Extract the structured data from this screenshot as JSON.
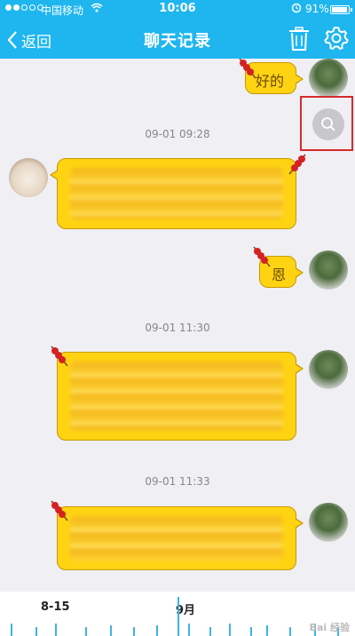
{
  "status": {
    "carrier": "中国移动",
    "time": "10:06",
    "battery": "91%"
  },
  "nav": {
    "back_label": "返回",
    "title": "聊天记录"
  },
  "messages": [
    {
      "type": "sent",
      "text": "好的"
    },
    {
      "type": "timestamp",
      "text": "09-01 09:28"
    },
    {
      "type": "received",
      "text": ""
    },
    {
      "type": "sent",
      "text": "恩"
    },
    {
      "type": "timestamp",
      "text": "09-01 11:30"
    },
    {
      "type": "sent",
      "text": ""
    },
    {
      "type": "timestamp",
      "text": "09-01 11:33"
    },
    {
      "type": "sent",
      "text": ""
    }
  ],
  "timeline": {
    "left_label": "8-15",
    "center_label": "9月"
  },
  "watermark": "Bai 经验",
  "colors": {
    "nav_bg": "#1fb6f0",
    "bubble": "#ffd312",
    "highlight_border": "#d52b2b"
  }
}
